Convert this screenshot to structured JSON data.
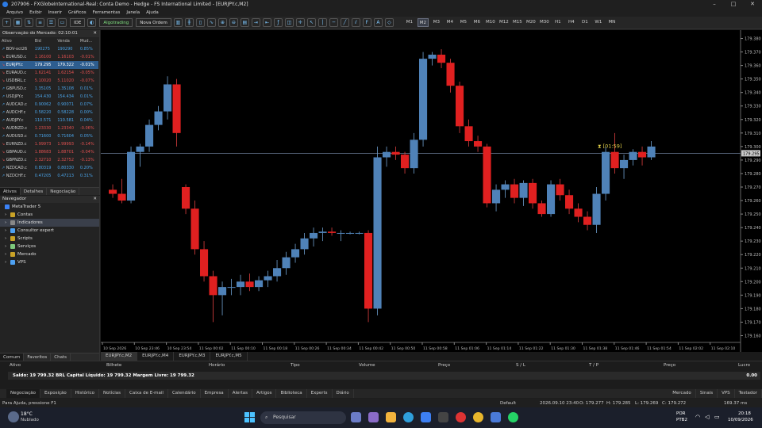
{
  "window": {
    "title": "207906 - FXGlobeInternational-Real: Conta Demo - Hedge - FS International Limited - [EURJPY.c,M2]"
  },
  "menu": [
    "Arquivo",
    "Exibir",
    "Inserir",
    "Gráficos",
    "Ferramentas",
    "Janela",
    "Ajuda"
  ],
  "toolbar": {
    "algo_label": "Algotrading",
    "new_order_label": "Nova Ordem",
    "ide_label": "IDE",
    "timeframes": [
      "M1",
      "M2",
      "M3",
      "M4",
      "M5",
      "M6",
      "M10",
      "M12",
      "M15",
      "M20",
      "M30",
      "H1",
      "H4",
      "D1",
      "W1",
      "MN"
    ],
    "active_tf": "M2"
  },
  "market_watch": {
    "title": "Observação do Mercado: 02:10:01",
    "columns": [
      "Ativo",
      "Bid",
      "Venda",
      "Mud..."
    ],
    "rows": [
      {
        "sym": "BOV-oct26",
        "bid": "190275",
        "ask": "190290",
        "chg": "0.85%",
        "dir": "up"
      },
      {
        "sym": "EURUSD.c",
        "bid": "1.16100",
        "ask": "1.16103",
        "chg": "-0.01%",
        "dir": "dn"
      },
      {
        "sym": "EURJPY.c",
        "bid": "179.295",
        "ask": "179.322",
        "chg": "-0.01%",
        "dir": "dn",
        "selected": true
      },
      {
        "sym": "EURAUD.c",
        "bid": "1.62141",
        "ask": "1.62154",
        "chg": "-0.05%",
        "dir": "dn"
      },
      {
        "sym": "USDBRL.c",
        "bid": "5.10020",
        "ask": "5.11020",
        "chg": "-0.07%",
        "dir": "dn"
      },
      {
        "sym": "GBPUSD.c",
        "bid": "1.35105",
        "ask": "1.35108",
        "chg": "0.01%",
        "dir": "up"
      },
      {
        "sym": "USDJPY.c",
        "bid": "154.430",
        "ask": "154.434",
        "chg": "0.01%",
        "dir": "up"
      },
      {
        "sym": "AUDCAD.c",
        "bid": "0.90062",
        "ask": "0.90071",
        "chg": "0.07%",
        "dir": "up"
      },
      {
        "sym": "AUDCHF.c",
        "bid": "0.58220",
        "ask": "0.58228",
        "chg": "0.00%",
        "dir": "up"
      },
      {
        "sym": "AUDJPY.c",
        "bid": "110.571",
        "ask": "110.581",
        "chg": "0.04%",
        "dir": "up"
      },
      {
        "sym": "AUDNZD.c",
        "bid": "1.23330",
        "ask": "1.23340",
        "chg": "-0.06%",
        "dir": "dn"
      },
      {
        "sym": "AUDUSD.c",
        "bid": "0.71600",
        "ask": "0.71604",
        "chg": "0.05%",
        "dir": "up"
      },
      {
        "sym": "EURNZD.c",
        "bid": "1.99973",
        "ask": "1.99993",
        "chg": "-0.14%",
        "dir": "dn"
      },
      {
        "sym": "GBPAUD.c",
        "bid": "1.88683",
        "ask": "1.88701",
        "chg": "-0.04%",
        "dir": "dn"
      },
      {
        "sym": "GBPNZD.c",
        "bid": "2.32710",
        "ask": "2.32752",
        "chg": "-0.13%",
        "dir": "dn"
      },
      {
        "sym": "NZDCAD.c",
        "bid": "0.80319",
        "ask": "0.80330",
        "chg": "0.20%",
        "dir": "up"
      },
      {
        "sym": "NZDCHF.c",
        "bid": "0.47205",
        "ask": "0.47213",
        "chg": "0.31%",
        "dir": "up"
      }
    ],
    "tabs": [
      "Ativos",
      "Detalhes",
      "Negociação"
    ]
  },
  "navigator": {
    "title": "Navegador",
    "root": "MetaTrader 5",
    "items": [
      "Contas",
      "Indicadores",
      "Consultor expert",
      "Scripts",
      "Serviços",
      "Mercado",
      "VPS"
    ],
    "selected": "Indicadores",
    "tabs": [
      "Comum",
      "Favoritos",
      "Chats"
    ]
  },
  "chart": {
    "timer": "[01:59]",
    "current_price": "179.295",
    "y_ticks": [
      "179.380",
      "179.370",
      "179.360",
      "179.350",
      "179.340",
      "179.330",
      "179.320",
      "179.310",
      "179.300",
      "179.290",
      "179.280",
      "179.270",
      "179.260",
      "179.250",
      "179.240",
      "179.230",
      "179.220",
      "179.210",
      "179.200",
      "179.190",
      "179.180",
      "179.170",
      "179.160"
    ],
    "x_ticks": [
      "10 Sep 2026",
      "10 Sep 23:46",
      "10 Sep 23:54",
      "11 Sep 00:02",
      "11 Sep 00:10",
      "11 Sep 00:18",
      "11 Sep 00:26",
      "11 Sep 00:34",
      "11 Sep 00:42",
      "11 Sep 00:50",
      "11 Sep 00:58",
      "11 Sep 01:06",
      "11 Sep 01:14",
      "11 Sep 01:22",
      "11 Sep 01:30",
      "11 Sep 01:38",
      "11 Sep 01:46",
      "11 Sep 01:54",
      "11 Sep 02:02",
      "11 Sep 02:10"
    ],
    "tabs": [
      "EURJPY.c,M2",
      "EURJPY.c,M4",
      "EURJPY.c,M3",
      "EURJPY.c,M5"
    ]
  },
  "chart_data": {
    "type": "candlestick",
    "ylim": [
      179.155,
      179.385
    ],
    "candles": [
      [
        179.268,
        179.272,
        179.262,
        179.265
      ],
      [
        179.265,
        179.276,
        179.258,
        179.26
      ],
      [
        179.26,
        179.3,
        179.258,
        179.296
      ],
      [
        179.296,
        179.302,
        179.285,
        179.3
      ],
      [
        179.3,
        179.32,
        179.296,
        179.316
      ],
      [
        179.316,
        179.33,
        179.312,
        179.326
      ],
      [
        179.326,
        179.352,
        179.32,
        179.346
      ],
      [
        179.346,
        179.35,
        179.3,
        179.31
      ],
      [
        179.27,
        179.272,
        179.25,
        179.254
      ],
      [
        179.254,
        179.26,
        179.22,
        179.224
      ],
      [
        179.224,
        179.23,
        179.2,
        179.204
      ],
      [
        179.204,
        179.208,
        179.17,
        179.19
      ],
      [
        179.19,
        179.2,
        179.175,
        179.196
      ],
      [
        179.196,
        179.202,
        179.19,
        179.196
      ],
      [
        179.196,
        179.205,
        179.19,
        179.2
      ],
      [
        179.2,
        179.206,
        179.193,
        179.196
      ],
      [
        179.196,
        179.204,
        179.193,
        179.201
      ],
      [
        179.201,
        179.208,
        179.196,
        179.204
      ],
      [
        179.204,
        179.216,
        179.2,
        179.21
      ],
      [
        179.21,
        179.222,
        179.205,
        179.218
      ],
      [
        179.218,
        179.228,
        179.214,
        179.224
      ],
      [
        179.224,
        179.236,
        179.22,
        179.232
      ],
      [
        179.232,
        179.24,
        179.226,
        179.236
      ],
      [
        179.236,
        179.24,
        179.23,
        179.237
      ],
      [
        179.237,
        179.24,
        179.234,
        179.236
      ],
      [
        179.236,
        179.238,
        179.23,
        179.236
      ],
      [
        179.236,
        179.237,
        179.235,
        179.236
      ],
      [
        179.236,
        179.237,
        179.235,
        179.236
      ],
      [
        179.236,
        179.238,
        179.17,
        179.18
      ],
      [
        179.18,
        179.3,
        179.175,
        179.292
      ],
      [
        179.292,
        179.3,
        179.285,
        179.296
      ],
      [
        179.296,
        179.3,
        179.29,
        179.294
      ],
      [
        179.294,
        179.296,
        179.28,
        179.284
      ],
      [
        179.284,
        179.31,
        179.28,
        179.305
      ],
      [
        179.305,
        179.37,
        179.3,
        179.365
      ],
      [
        179.365,
        179.37,
        179.36,
        179.368
      ],
      [
        179.368,
        179.372,
        179.358,
        179.362
      ],
      [
        179.362,
        179.365,
        179.34,
        179.345
      ],
      [
        179.345,
        179.348,
        179.31,
        179.315
      ],
      [
        179.315,
        179.32,
        179.3,
        179.304
      ],
      [
        179.304,
        179.308,
        179.296,
        179.3
      ],
      [
        179.3,
        179.302,
        179.255,
        179.258
      ],
      [
        179.258,
        179.272,
        179.252,
        179.268
      ],
      [
        179.268,
        179.275,
        179.262,
        179.272
      ],
      [
        179.272,
        179.276,
        179.258,
        179.262
      ],
      [
        179.262,
        179.275,
        179.256,
        179.273
      ],
      [
        179.273,
        179.276,
        179.254,
        179.258
      ],
      [
        179.258,
        179.26,
        179.248,
        179.25
      ],
      [
        179.25,
        179.275,
        179.248,
        179.272
      ],
      [
        179.272,
        179.276,
        179.26,
        179.264
      ],
      [
        179.264,
        179.268,
        179.25,
        179.254
      ],
      [
        179.254,
        179.258,
        179.244,
        179.248
      ],
      [
        179.248,
        179.252,
        179.238,
        179.242
      ],
      [
        179.242,
        179.27,
        179.236,
        179.265
      ],
      [
        179.265,
        179.3,
        179.26,
        179.296
      ],
      [
        179.296,
        179.31,
        179.28,
        179.284
      ],
      [
        179.284,
        179.294,
        179.276,
        179.29
      ],
      [
        179.29,
        179.298,
        179.286,
        179.296
      ],
      [
        179.296,
        179.3,
        179.286,
        179.292
      ],
      [
        179.292,
        179.304,
        179.29,
        179.3
      ]
    ]
  },
  "toolbox": {
    "columns": [
      "Ativo",
      "Bilhete",
      "Horário",
      "Tipo",
      "Volume",
      "Preço",
      "S / L",
      "T / P",
      "Preço",
      "Lucro"
    ],
    "saldo": "Saldo: 19 799.32 BRL  Capital Líquido: 19 799.32  Margem Livre: 19 799.32",
    "profit": "0.00",
    "tabs": [
      "Negociação",
      "Exposição",
      "Histórico",
      "Notícias",
      "Caixa de E-mail",
      "Calendário",
      "Empresa",
      "Alertas",
      "Artigos",
      "Biblioteca",
      "Experts",
      "Diário"
    ],
    "right_tabs": [
      "Mercado",
      "Sinais",
      "VPS",
      "Testador"
    ]
  },
  "status": {
    "help": "Para Ajuda, pressione F1",
    "profile": "Default",
    "datetime": "2026.09.10 23:40",
    "o": "O: 179.277",
    "h": "H: 179.285",
    "l": "L: 179.269",
    "c": "C: 179.272",
    "ping": "169.37 ms"
  },
  "taskbar": {
    "weather_temp": "18°C",
    "weather_text": "Nublado",
    "search": "Pesquisar",
    "lang": "POR",
    "lang2": "PTB2",
    "time": "20:18",
    "date": "10/09/2026"
  }
}
